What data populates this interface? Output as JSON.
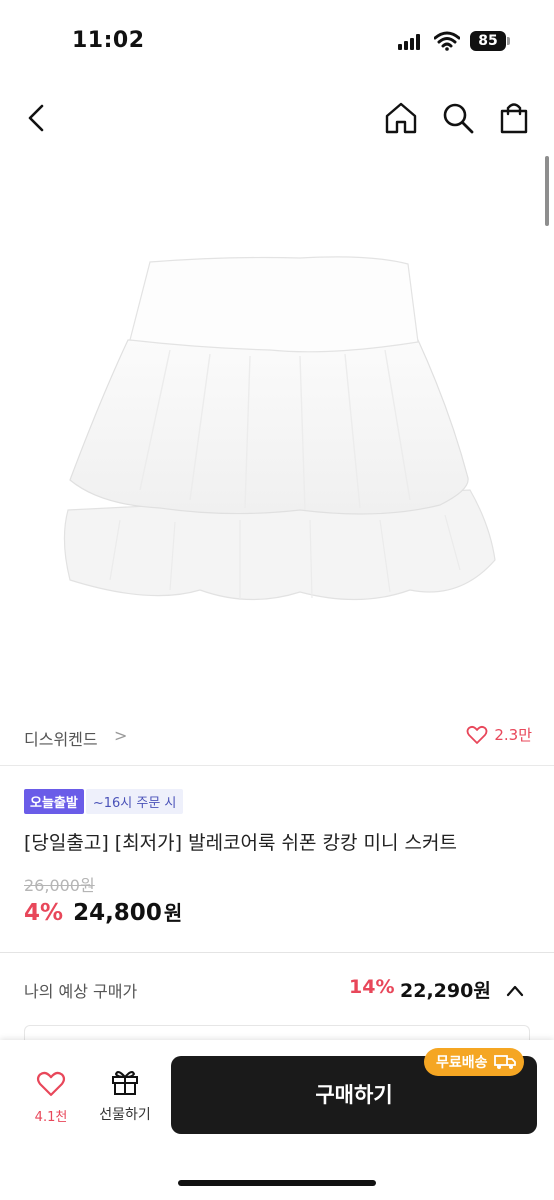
{
  "status_bar": {
    "time": "11:02",
    "battery": "85"
  },
  "nav": {
    "icons": [
      "back-icon",
      "home-icon",
      "search-icon",
      "cart-icon"
    ]
  },
  "brand": {
    "name": "디스위켄드",
    "chevron": ">",
    "like_count": "2.3만"
  },
  "badges": {
    "today": "오늘출발",
    "cutoff": "~16시 주문 시"
  },
  "product": {
    "title": "[당일출고] [최저가] 발레코어룩 쉬폰 캉캉 미니 스커트",
    "original_price": "26,000원",
    "discount_rate": "4%",
    "sale_price": "24,800",
    "sale_unit": "원"
  },
  "expected_price": {
    "label": "나의 예상 구매가",
    "rate": "14%",
    "price": "22,290원"
  },
  "bottom_bar": {
    "wish_count": "4.1천",
    "gift_label": "선물하기",
    "buy_label": "구매하기",
    "free_shipping": "무료배송"
  },
  "colors": {
    "accent_red": "#e8475a",
    "badge_purple": "#6a5ce8",
    "free_ship_orange": "#f5a623",
    "buy_button": "#1a1a1a"
  }
}
